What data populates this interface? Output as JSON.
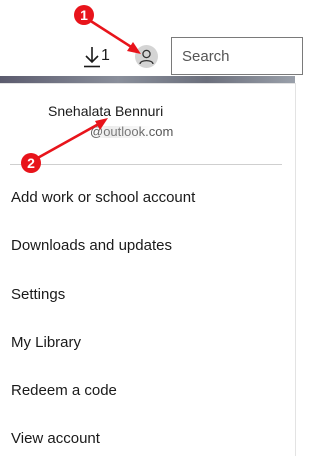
{
  "header": {
    "downloads_count": "1",
    "search": {
      "placeholder": "Search"
    }
  },
  "account": {
    "name": "Snehalata Bennuri",
    "email_visible": "@outlook.com"
  },
  "menu": {
    "items": [
      {
        "label": "Add work or school account"
      },
      {
        "label": "Downloads and updates"
      },
      {
        "label": "Settings"
      },
      {
        "label": "My Library"
      },
      {
        "label": "Redeem a code"
      },
      {
        "label": "View account"
      }
    ]
  },
  "annotations": {
    "markers": [
      {
        "label": "1"
      },
      {
        "label": "2"
      }
    ],
    "color": "#e8141b"
  },
  "icons": [
    "download-icon",
    "user-avatar-icon"
  ]
}
